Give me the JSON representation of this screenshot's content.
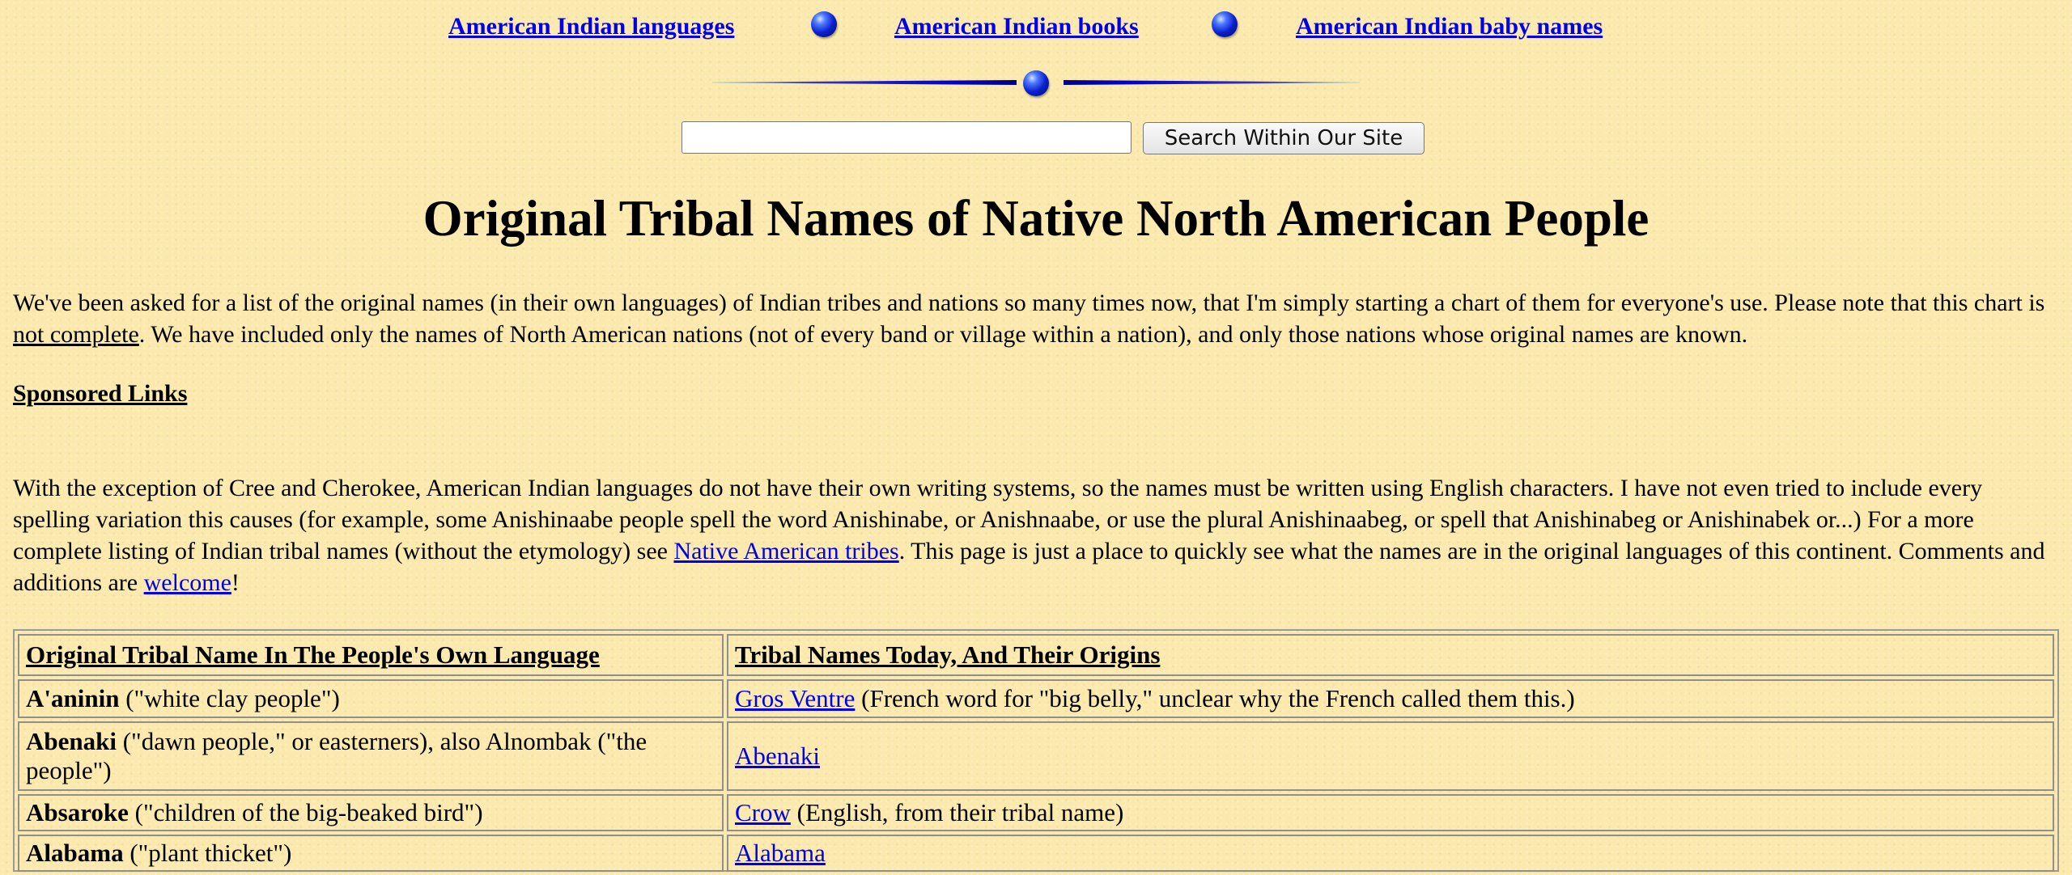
{
  "topnav": {
    "links": [
      "American Indian languages",
      "American Indian books",
      "American Indian baby names"
    ]
  },
  "search": {
    "value": "",
    "button_label": "Search Within Our Site"
  },
  "page_title": "Original Tribal Names of Native North American People",
  "intro": {
    "before": "We've been asked for a list of the original names (in their own languages) of Indian tribes and nations so many times now, that I'm simply starting a chart of them for everyone's use. Please note that this chart is ",
    "underlined": "not complete",
    "after": ". We have included only the names of North American nations (not of every band or village within a nation), and only those nations whose original names are known."
  },
  "sponsored_links": "Sponsored Links",
  "spelling_note": {
    "text1": "With the exception of Cree and Cherokee, American Indian languages do not have their own writing systems, so the names must be written using English characters. I have not even tried to include every spelling variation this causes (for example, some Anishinaabe people spell the word Anishinabe, or Anishnaabe, or use the plural Anishinaabeg, or spell that Anishinabeg or Anishinabek or...) For a more complete listing of Indian tribal names (without the etymology) see ",
    "link1": "Native American tribes",
    "text2": ". This page is just a place to quickly see what the names are in the original languages of this continent. Comments and additions are ",
    "link2": "welcome",
    "text3": "!"
  },
  "table": {
    "headers": [
      "Original Tribal Name In The People's Own Language",
      "Tribal Names Today, And Their Origins"
    ],
    "rows": [
      {
        "name": "A'aninin",
        "meaning": " (\"white clay people\")",
        "link": "Gros Ventre",
        "origin": " (French word for \"big belly,\" unclear why the French called them this.)"
      },
      {
        "name": "Abenaki",
        "meaning": " (\"dawn people,\" or easterners), also Alnombak (\"the people\")",
        "link": "Abenaki",
        "origin": ""
      },
      {
        "name": "Absaroke",
        "meaning": " (\"children of the big-beaked bird\")",
        "link": "Crow",
        "origin": " (English, from their tribal name)"
      },
      {
        "name": "Alabama",
        "meaning": " (\"plant thicket\")",
        "link": "Alabama",
        "origin": ""
      }
    ]
  },
  "colors": {
    "background": "#fbe9ad",
    "link": "#0000ee",
    "orb": "#0a1fd1"
  },
  "icons": [
    "orb-icon",
    "orb-icon",
    "orb-icon"
  ]
}
